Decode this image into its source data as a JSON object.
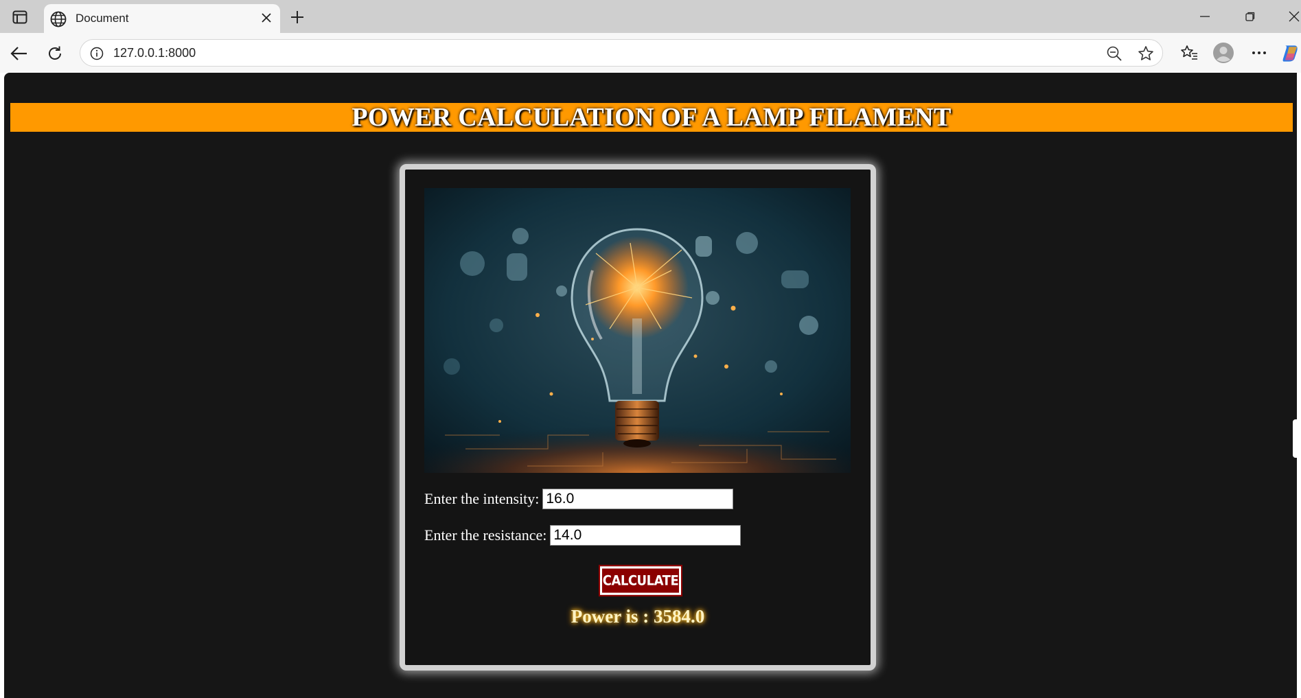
{
  "browser": {
    "tab_title": "Document",
    "url": "127.0.0.1:8000"
  },
  "page": {
    "banner_title": "POWER CALCULATION OF A LAMP FILAMENT",
    "image_subject": "glowing light bulb",
    "form": {
      "intensity_label": "Enter the intensity:",
      "intensity_value": "16.0",
      "resistance_label": "Enter the resistance:",
      "resistance_value": "14.0",
      "calculate_label": "CALCULATE"
    },
    "result_text": "Power is : 3584.0"
  },
  "colors": {
    "banner": "#ff9900",
    "page_bg": "#161616",
    "button": "#8b0000",
    "result_glow": "#ffcc33"
  }
}
